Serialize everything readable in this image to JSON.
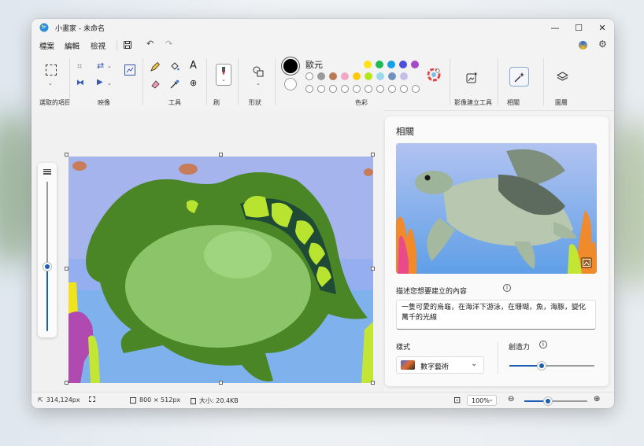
{
  "window": {
    "title": "小畫家 - 未命名"
  },
  "menu": {
    "file": "檔案",
    "edit": "編輯",
    "view": "檢視"
  },
  "ribbon": {
    "selection_label": "選取的項目",
    "image_label": "映像",
    "tools_label": "工具",
    "brushes_label": "刷",
    "shapes_label": "形狀",
    "colors_label": "色彩",
    "color_name": "歐元",
    "image_creator_label": "影像建立工具",
    "related_label": "相關",
    "layers_label": "圖層",
    "palette_row1": [
      "#ffe21a",
      "#1fb955",
      "#1a9ee6",
      "#4f4fd9",
      "#a54bc6"
    ],
    "palette_row2": [
      "#ffffff",
      "#9a9a9a",
      "#b97a57",
      "#f4a6c8",
      "#ffc90e",
      "#b5e61d",
      "#99d9ea",
      "#7092be",
      "#c8bfe7"
    ],
    "primary_color": "#000000",
    "secondary_color": "#ffffff"
  },
  "panel": {
    "title": "相關",
    "prompt_label": "描述您想要建立的內容",
    "prompt_text": "一隻可愛的烏龜，在海洋下游泳，在珊瑚，魚，海豚，變化萬千的光線",
    "style_label": "樣式",
    "style_value": "數字藝術",
    "creativity_label": "創造力",
    "creativity_level": 0.38
  },
  "statusbar": {
    "cursor_pos": "314,124px",
    "canvas_size": "800 × 512px",
    "file_size": "大小: 20.4KB",
    "zoom": "100%",
    "zoom_level": 0.38
  },
  "zoom_slider_level": 0.57
}
